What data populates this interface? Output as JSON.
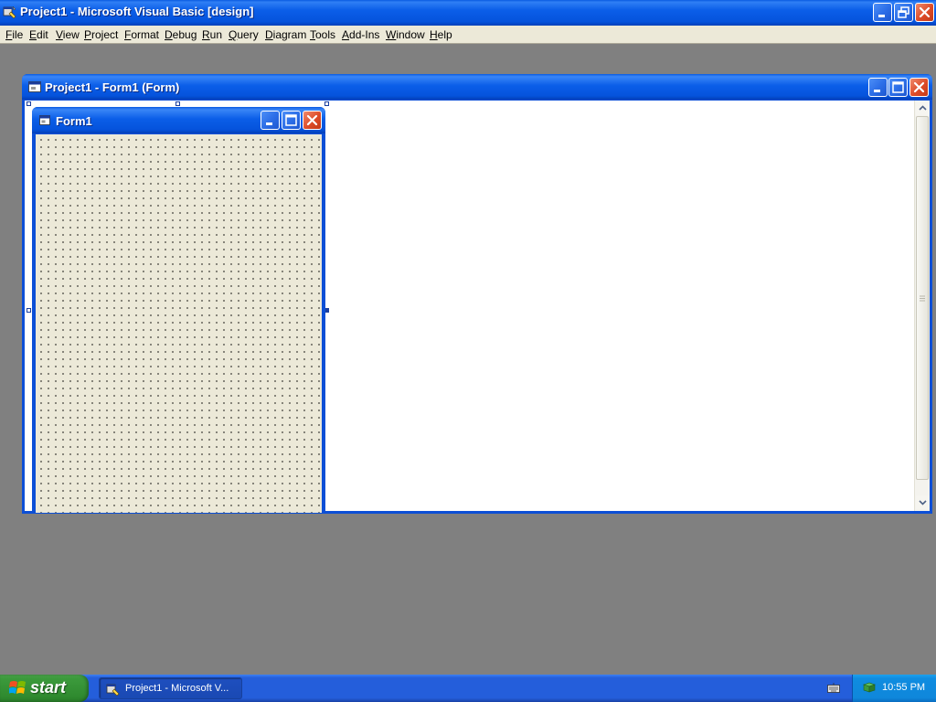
{
  "app": {
    "title": "Project1 - Microsoft Visual Basic [design]"
  },
  "menu": {
    "items": [
      "File",
      "Edit",
      "View",
      "Project",
      "Format",
      "Debug",
      "Run",
      "Query",
      "Diagram",
      "Tools",
      "Add-Ins",
      "Window",
      "Help"
    ]
  },
  "mdi_window": {
    "title": "Project1 - Form1 (Form)"
  },
  "form": {
    "title": "Form1"
  },
  "taskbar": {
    "start_label": "start",
    "task_label": "Project1 - Microsoft V...",
    "clock": "10:55 PM"
  },
  "colors": {
    "titlebar_blue": "#0553dc",
    "desktop_gray": "#808080",
    "form_background": "#ece9d8",
    "taskbar_blue": "#245edb",
    "start_green": "#3c9a3c"
  }
}
